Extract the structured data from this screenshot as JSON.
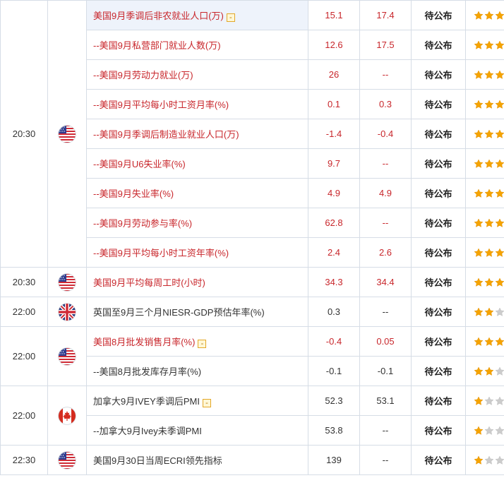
{
  "status_label": "待公布",
  "colors": {
    "accent_red": "#c8262b",
    "star_gold": "#f5a300",
    "star_gray": "#cccccc",
    "border": "#d6dde6"
  },
  "rows": [
    {
      "time": "20:30",
      "flag": "us-flag-icon",
      "name": "美国9月季调后非农就业人口(万)",
      "marked": true,
      "prev": "15.1",
      "pred": "17.4",
      "status": "待公布",
      "stars": 3,
      "red": true,
      "group_start": true,
      "rowspan": 9
    },
    {
      "name": "--美国9月私营部门就业人数(万)",
      "prev": "12.6",
      "pred": "17.5",
      "status": "待公布",
      "stars": 3,
      "red": true
    },
    {
      "name": "--美国9月劳动力就业(万)",
      "prev": "26",
      "pred": "--",
      "status": "待公布",
      "stars": 3,
      "red": true
    },
    {
      "name": "--美国9月平均每小时工资月率(%)",
      "prev": "0.1",
      "pred": "0.3",
      "status": "待公布",
      "stars": 3,
      "red": true
    },
    {
      "name": "--美国9月季调后制造业就业人口(万)",
      "prev": "-1.4",
      "pred": "-0.4",
      "status": "待公布",
      "stars": 3,
      "red": true
    },
    {
      "name": "--美国9月U6失业率(%)",
      "prev": "9.7",
      "pred": "--",
      "status": "待公布",
      "stars": 3,
      "red": true
    },
    {
      "name": "--美国9月失业率(%)",
      "prev": "4.9",
      "pred": "4.9",
      "status": "待公布",
      "stars": 3,
      "red": true
    },
    {
      "name": "--美国9月劳动参与率(%)",
      "prev": "62.8",
      "pred": "--",
      "status": "待公布",
      "stars": 3,
      "red": true
    },
    {
      "name": "--美国9月平均每小时工资年率(%)",
      "prev": "2.4",
      "pred": "2.6",
      "status": "待公布",
      "stars": 3,
      "red": true
    },
    {
      "time": "20:30",
      "flag": "us-flag-icon",
      "name": "美国9月平均每周工时(小时)",
      "prev": "34.3",
      "pred": "34.4",
      "status": "待公布",
      "stars": 3,
      "red": true,
      "group_start": true,
      "rowspan": 1
    },
    {
      "time": "22:00",
      "flag": "uk-flag-icon",
      "name": "英国至9月三个月NIESR-GDP预估年率(%)",
      "prev": "0.3",
      "pred": "--",
      "status": "待公布",
      "stars": 2,
      "red": false,
      "group_start": true,
      "rowspan": 1
    },
    {
      "time": "22:00",
      "flag": "us-flag-icon",
      "name": "美国8月批发销售月率(%)",
      "marked": true,
      "prev": "-0.4",
      "pred": "0.05",
      "status": "待公布",
      "stars": 3,
      "red": true,
      "group_start": true,
      "rowspan": 2
    },
    {
      "name": "--美国8月批发库存月率(%)",
      "prev": "-0.1",
      "pred": "-0.1",
      "status": "待公布",
      "stars": 2,
      "red": false
    },
    {
      "time": "22:00",
      "flag": "ca-flag-icon",
      "name": "加拿大9月IVEY季调后PMI",
      "marked": true,
      "prev": "52.3",
      "pred": "53.1",
      "status": "待公布",
      "stars": 1,
      "red": false,
      "group_start": true,
      "rowspan": 2
    },
    {
      "name": "--加拿大9月Ivey未季调PMI",
      "prev": "53.8",
      "pred": "--",
      "status": "待公布",
      "stars": 1,
      "red": false
    },
    {
      "time": "22:30",
      "flag": "us-flag-icon",
      "name": "美国9月30日当周ECRI领先指标",
      "prev": "139",
      "pred": "--",
      "status": "待公布",
      "stars": 1,
      "red": false,
      "group_start": true,
      "rowspan": 1
    }
  ]
}
